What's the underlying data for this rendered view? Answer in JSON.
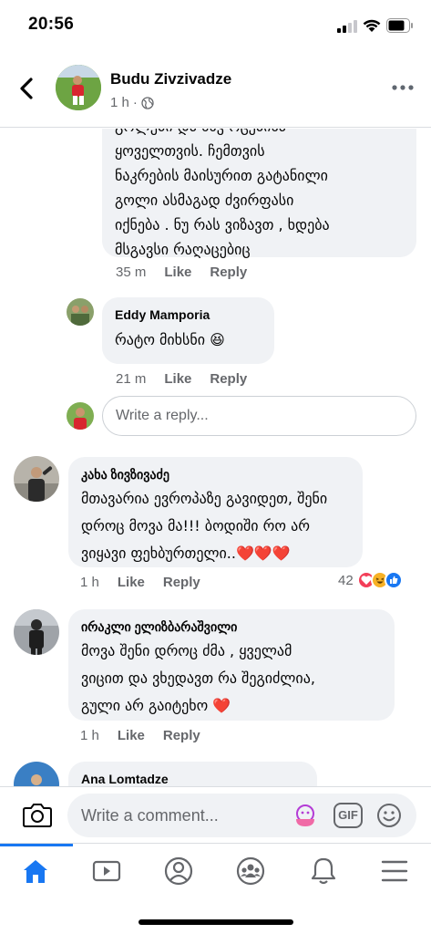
{
  "status_bar": {
    "time": "20:56"
  },
  "header": {
    "author": "Budu Zivzivadze",
    "time": "1 h",
    "visibility_icon": "globe-icon"
  },
  "comments": [
    {
      "id": "c1",
      "text_lines": [
        "ყოველთვის.  ჩემთვის",
        "ნაკრების მაისურით გატანილი",
        "გოლი ასმაგად ძვირფასი",
        "იქნება .  ნუ რას ვიზავთ , ხდება",
        "მსგავსი რაღაცებიც"
      ],
      "clipped_line": "გოლები და სხვ ოცებისა",
      "time": "35 m",
      "like": "Like",
      "reply": "Reply"
    },
    {
      "id": "c2",
      "name": "Eddy Mamporia",
      "text": "რატო მიხსნი 😆",
      "time": "21 m",
      "like": "Like",
      "reply": "Reply"
    },
    {
      "id": "c3",
      "name": "კახა ზივზივაძე",
      "text_lines": [
        "მთავარია ევროპაზე გავიდეთ, შენი",
        "დროც მოვა მა!!! ბოდიში რო არ",
        "ვიყავი ფეხბურთელი..❤️❤️❤️"
      ],
      "time": "1 h",
      "like": "Like",
      "reply": "Reply",
      "reaction_count": "42"
    },
    {
      "id": "c4",
      "name": "ირაკლი ელიზბარაშვილი",
      "text_lines": [
        "მოვა შენი დროც ძმა , ყველამ",
        "ვიცით და ვხედავთ რა შეგიძლია,",
        "გული არ გაიტეხო ❤️"
      ],
      "time": "1 h",
      "like": "Like",
      "reply": "Reply"
    },
    {
      "id": "c5",
      "name": "Ana Lomtadze"
    }
  ],
  "reply_input": {
    "placeholder": "Write a reply..."
  },
  "composer": {
    "placeholder": "Write a comment...",
    "gif_label": "GIF"
  },
  "tabs": [
    "home-icon",
    "video-icon",
    "profile-icon",
    "groups-icon",
    "notifications-icon",
    "menu-icon"
  ],
  "colors": {
    "accent": "#1877f2",
    "bubble": "#f0f2f5",
    "secondary_text": "#65676b",
    "love": "#f33e58",
    "haha": "#f7b125"
  }
}
